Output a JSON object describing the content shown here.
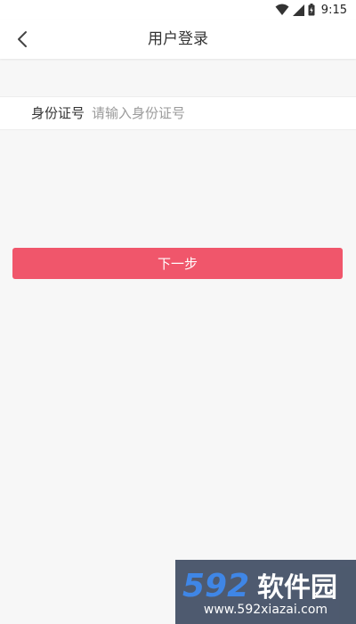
{
  "status_bar": {
    "time": "9:15",
    "icons": [
      "wifi-icon",
      "signal-icon",
      "battery-icon"
    ]
  },
  "header": {
    "title": "用户登录",
    "back_icon": "chevron-left-icon"
  },
  "form": {
    "id_label": "身份证号",
    "id_placeholder": "请输入身份证号",
    "id_value": ""
  },
  "actions": {
    "next_label": "下一步"
  },
  "watermark": {
    "logo_text": "592软件园",
    "url": "www.592xiazai.com"
  },
  "colors": {
    "accent": "#f0566b",
    "background": "#f7f7f7",
    "surface": "#ffffff",
    "text_primary": "#333333",
    "placeholder": "#9a9a9a"
  }
}
